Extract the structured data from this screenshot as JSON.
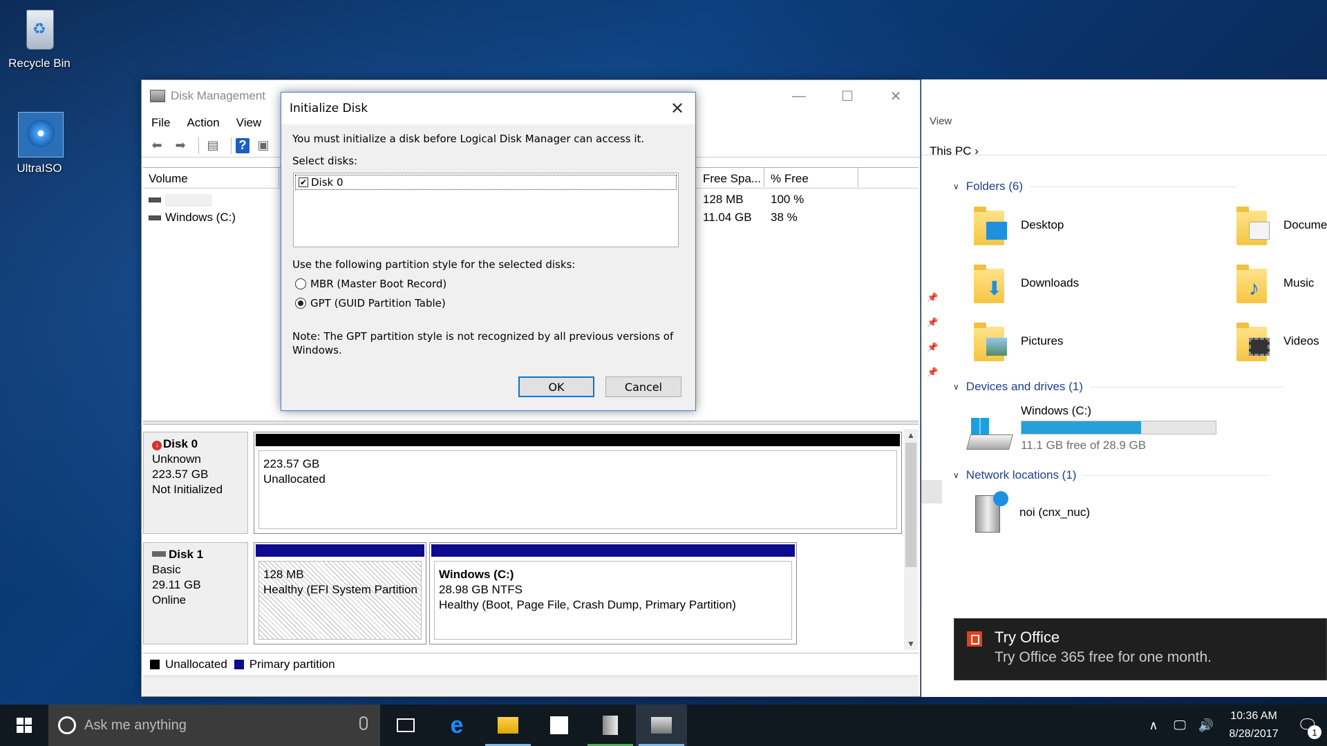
{
  "desktop": {
    "icons": [
      {
        "label": "Recycle Bin",
        "icon": "recycle-bin-icon"
      },
      {
        "label": "UltraISO",
        "icon": "ultraiso-icon"
      }
    ]
  },
  "disk_management": {
    "title": "Disk Management",
    "menu": [
      "File",
      "Action",
      "View"
    ],
    "columns": {
      "volume": "Volume",
      "free_space": "Free Spa...",
      "pct_free": "% Free"
    },
    "rows": [
      {
        "volume": "",
        "free_space": "128 MB",
        "pct_free": "100 %"
      },
      {
        "volume": "Windows (C:)",
        "free_space": "11.04 GB",
        "pct_free": "38 %"
      }
    ],
    "disks": [
      {
        "name": "Disk 0",
        "type": "Unknown",
        "size": "223.57 GB",
        "status": "Not Initialized",
        "partition": {
          "size": "223.57 GB",
          "status": "Unallocated"
        }
      },
      {
        "name": "Disk 1",
        "type": "Basic",
        "size": "29.11 GB",
        "status": "Online",
        "efi": {
          "size": "128 MB",
          "status": "Healthy (EFI System Partition"
        },
        "windows": {
          "name": "Windows  (C:)",
          "detail": "28.98 GB NTFS",
          "status": "Healthy (Boot, Page File, Crash Dump, Primary Partition)"
        }
      }
    ],
    "legend": {
      "unallocated": "Unallocated",
      "primary": "Primary partition"
    }
  },
  "init_dialog": {
    "title": "Initialize Disk",
    "intro": "You must initialize a disk before Logical Disk Manager can access it.",
    "select_label": "Select disks:",
    "disk_item": "Disk 0",
    "style_label": "Use the following partition style for the selected disks:",
    "mbr": "MBR (Master Boot Record)",
    "gpt": "GPT (GUID Partition Table)",
    "note_line1": "Note: The GPT partition style is not recognized by all previous versions of",
    "note_line2": "Windows.",
    "ok": "OK",
    "cancel": "Cancel"
  },
  "explorer": {
    "view_label": "View",
    "address": "This PC",
    "folders_head": "Folders (6)",
    "folders": [
      "Desktop",
      "Docume",
      "Downloads",
      "Music",
      "Pictures",
      "Videos"
    ],
    "devices_head": "Devices and drives (1)",
    "drive_name": "Windows (C:)",
    "drive_free": "11.1 GB free of 28.9 GB",
    "drive_used_fraction": 0.616,
    "network_head": "Network locations (1)",
    "network_item": "noi (cnx_nuc)"
  },
  "toast": {
    "title": "Try Office",
    "body": "Try Office 365 free for one month."
  },
  "taskbar": {
    "search_placeholder": "Ask me anything",
    "time": "10:36 AM",
    "date": "8/28/2017",
    "notifications": "1"
  },
  "colors": {
    "accent": "#0078d7",
    "primary_partition": "#0d0b8e",
    "drive_bar": "#26a0da",
    "office": "#e4401b"
  }
}
